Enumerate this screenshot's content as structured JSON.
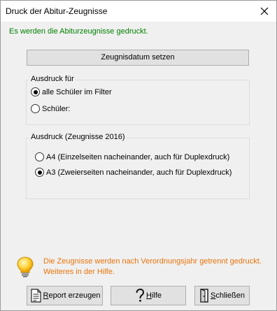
{
  "window": {
    "title": "Druck der Abitur-Zeugnisse",
    "close_glyph": "✕"
  },
  "info": "Es werden die Abiturzeugnisse gedruckt.",
  "date_button": "Zeugnisdatum setzen",
  "ausdruck_fuer": {
    "legend": "Ausdruck für",
    "options": [
      {
        "label": "alle Schüler im Filter",
        "checked": true
      },
      {
        "label": "Schüler:",
        "checked": false
      }
    ]
  },
  "ausdruck_zeugnisse": {
    "legend": "Ausdruck (Zeugnisse 2016)",
    "options": [
      {
        "label": "A4 (Einzelseiten nacheinander, auch für Duplexdruck)",
        "checked": false
      },
      {
        "label": "A3 (Zweierseiten nacheinander, auch für Duplexdruck)",
        "checked": true
      }
    ]
  },
  "hint": {
    "icon": "lightbulb-icon",
    "text": "Die Zeugnisse werden nach Verordnungsjahr getrennt gedruckt. Weiteres in der Hilfe."
  },
  "buttons": {
    "report": {
      "underlined_char": "R",
      "rest": "eport erzeugen",
      "icon": "report-document-icon"
    },
    "help": {
      "underlined_char": "H",
      "rest": "ilfe",
      "icon": "question-mark-icon"
    },
    "close": {
      "underlined_char": "S",
      "rest": "chließen",
      "icon": "door-exit-icon"
    }
  },
  "colors": {
    "info_green": "#008000",
    "hint_orange": "#e8740a",
    "button_face": "#e1e1e1",
    "dialog_bg": "#f0f0f0"
  }
}
